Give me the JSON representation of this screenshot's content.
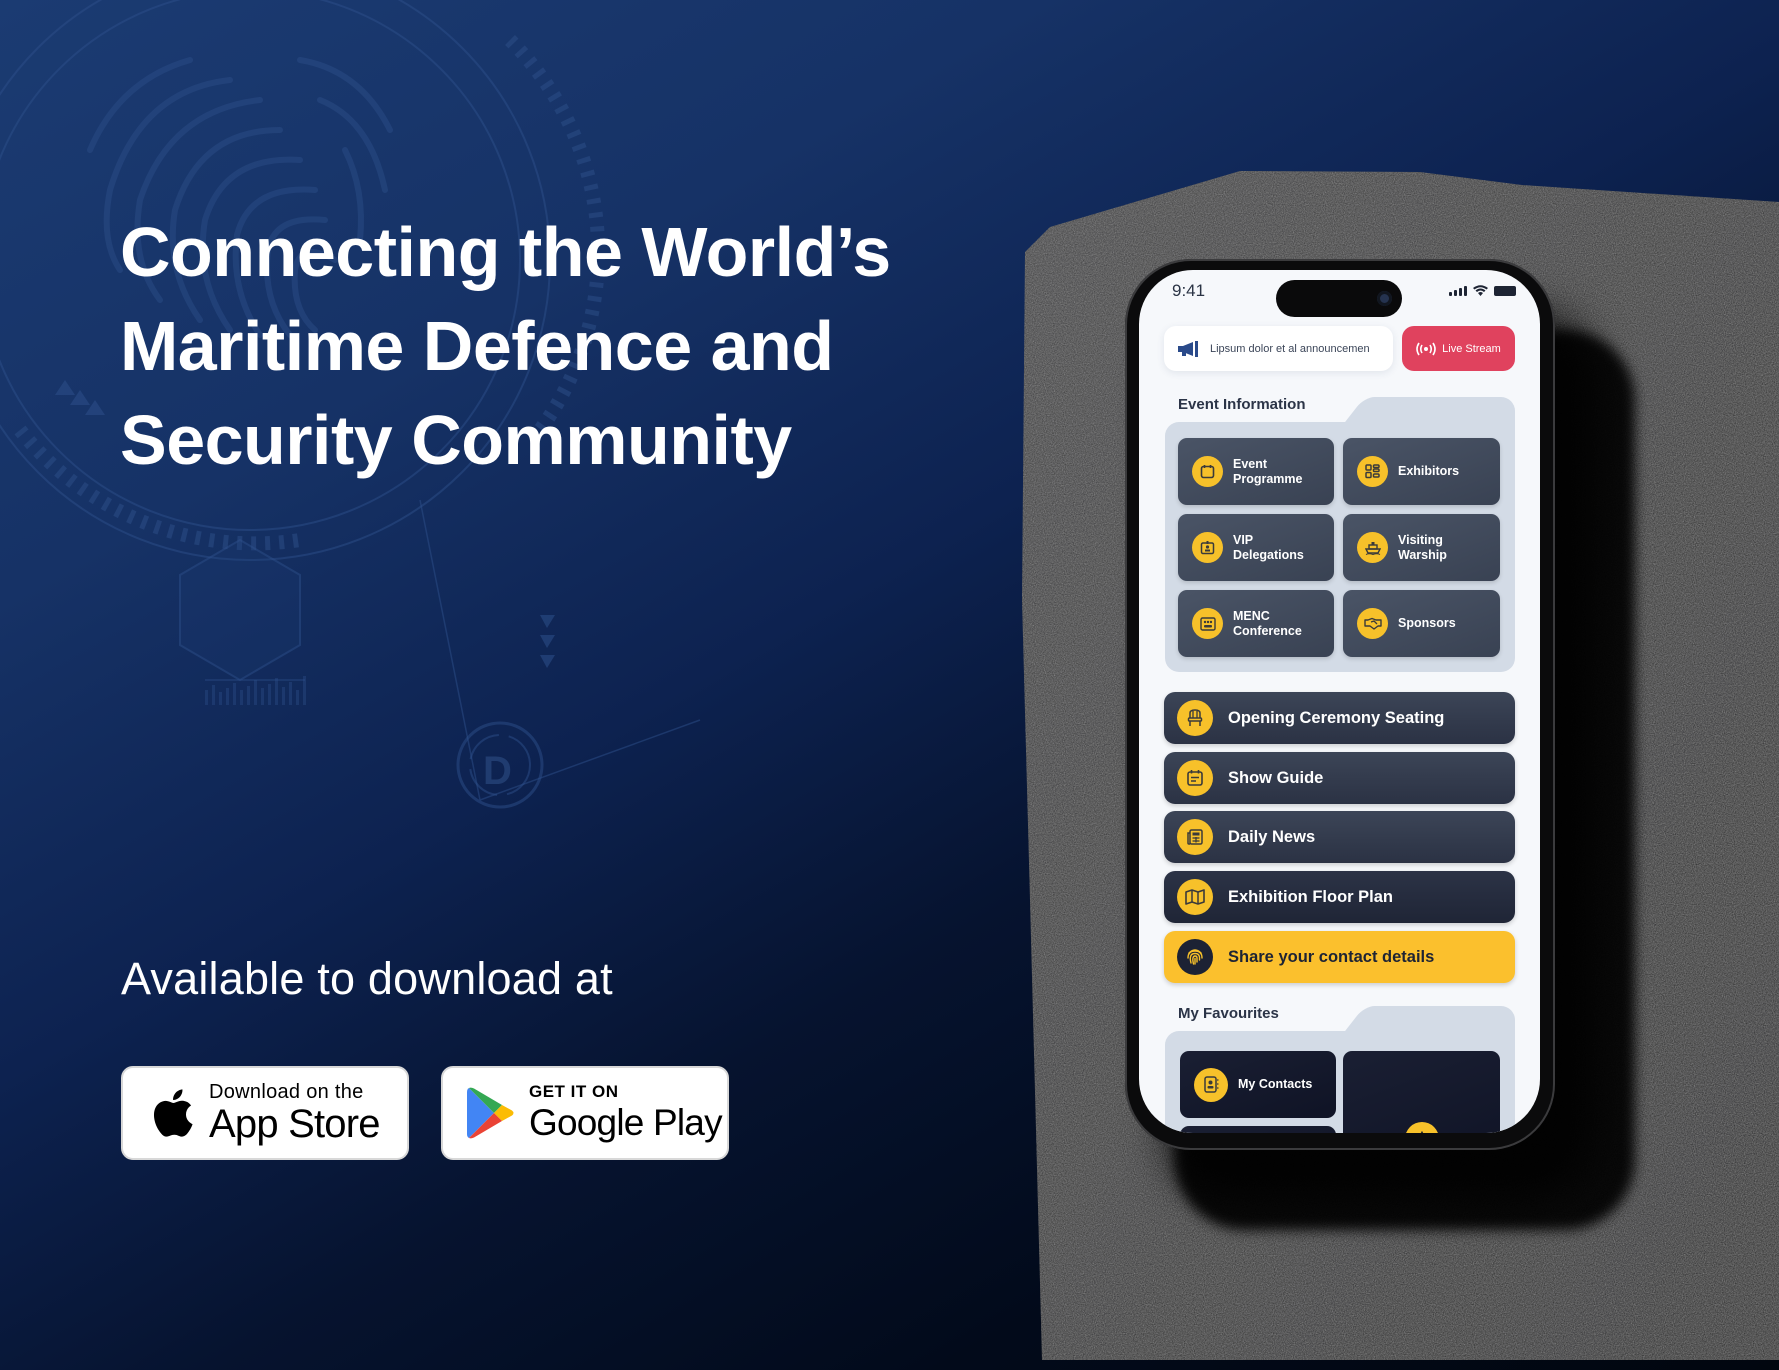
{
  "hero": {
    "headline_lines": [
      "Connecting the World’s",
      "Maritime Defence and",
      "Security Community"
    ],
    "available_text": "Available to download at"
  },
  "stores": {
    "apple": {
      "small": "Download on the",
      "big": "App Store"
    },
    "google": {
      "small": "GET IT ON",
      "big": "Google Play"
    }
  },
  "phone": {
    "status_time": "9:41",
    "announcement": "Lipsum dolor et al announcemen",
    "live_stream_label": "Live Stream",
    "event_info_title": "Event Information",
    "tiles": [
      {
        "label_line1": "Event",
        "label_line2": "Programme",
        "icon": "calendar-icon"
      },
      {
        "label_line1": "Exhibitors",
        "label_line2": "",
        "icon": "grid-icon"
      },
      {
        "label_line1": "VIP",
        "label_line2": "Delegations",
        "icon": "id-badge-icon"
      },
      {
        "label_line1": "Visiting",
        "label_line2": "Warship",
        "icon": "ship-icon"
      },
      {
        "label_line1": "MENC",
        "label_line2": "Conference",
        "icon": "conference-icon"
      },
      {
        "label_line1": "Sponsors",
        "label_line2": "",
        "icon": "handshake-icon"
      }
    ],
    "list_buttons": [
      {
        "label": "Opening Ceremony Seating",
        "icon": "chair-icon"
      },
      {
        "label": "Show Guide",
        "icon": "guide-icon"
      },
      {
        "label": "Daily News",
        "icon": "newspaper-icon"
      },
      {
        "label": "Exhibition Floor Plan",
        "icon": "map-icon"
      },
      {
        "label": "Share your contact details",
        "icon": "fingerprint-icon"
      }
    ],
    "favourites_title": "My Favourites",
    "favourites": [
      {
        "label": "My Contacts",
        "icon": "contacts-icon"
      },
      {
        "label": "",
        "icon": "star-icon"
      }
    ]
  },
  "colors": {
    "accent_yellow": "#f7c12a",
    "live_red": "#e0425e",
    "tile_dark": "#3e4759",
    "navy_bg": "#1b3b72"
  }
}
